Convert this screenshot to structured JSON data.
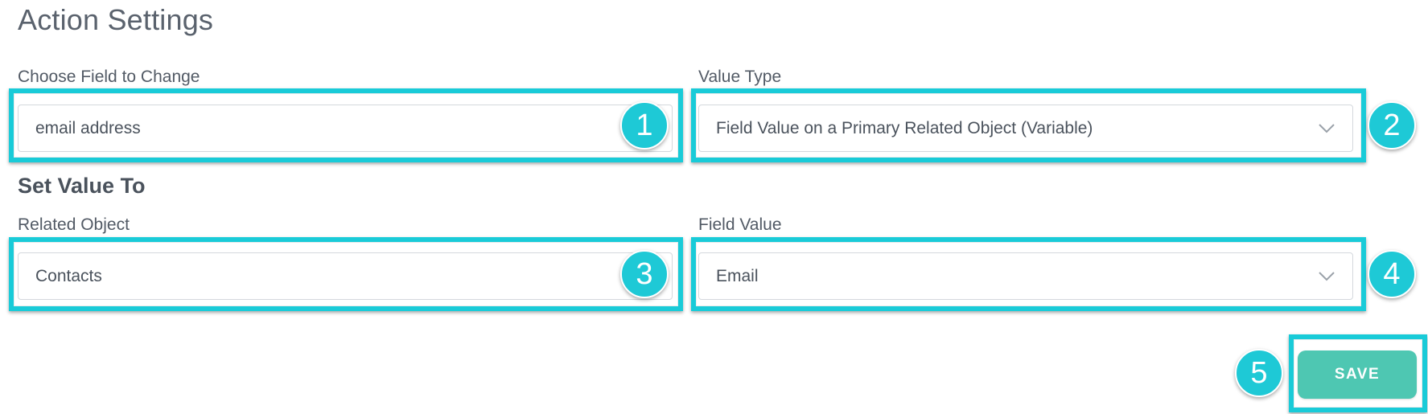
{
  "page": {
    "title": "Action Settings"
  },
  "choose_field": {
    "label": "Choose Field to Change",
    "value": "email address",
    "badge": "1"
  },
  "value_type": {
    "label": "Value Type",
    "value": "Field Value on a Primary Related Object (Variable)",
    "badge": "2"
  },
  "set_value": {
    "heading": "Set Value To"
  },
  "related_object": {
    "label": "Related Object",
    "value": "Contacts",
    "badge": "3"
  },
  "field_value": {
    "label": "Field Value",
    "value": "Email",
    "badge": "4"
  },
  "save": {
    "label": "SAVE",
    "badge": "5"
  },
  "colors": {
    "highlight": "#19cbd8",
    "badge": "#1ec9d6",
    "save_button": "#4ec7b2",
    "text": "#4a525c"
  },
  "icons": {
    "dropdown": "chevron-down-icon"
  }
}
